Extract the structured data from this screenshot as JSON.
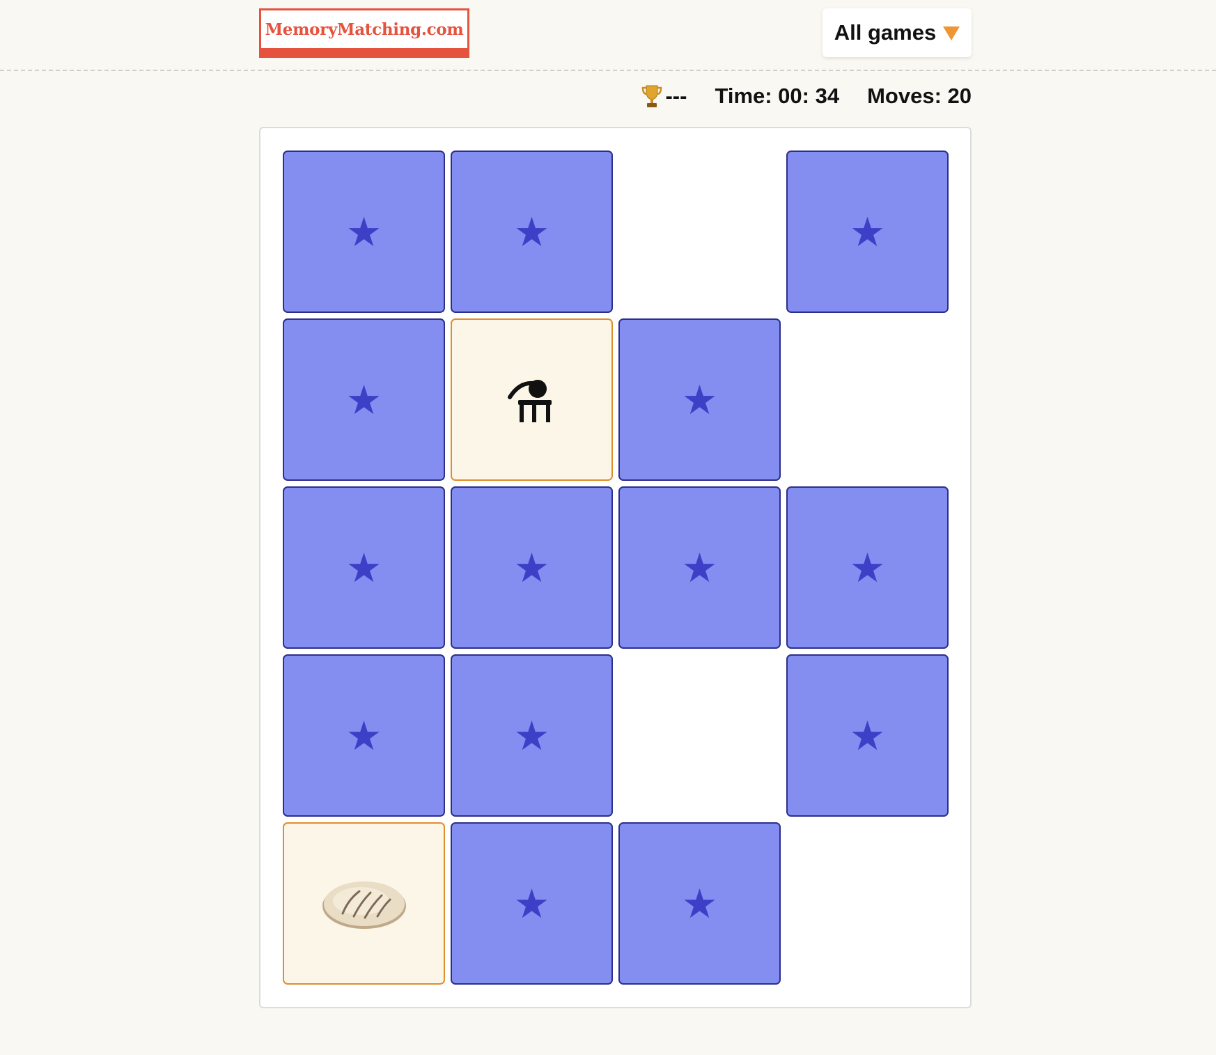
{
  "header": {
    "logo_text": "MemoryMatching.com",
    "menu_label": "All games",
    "menu_icon": "chevron-down-icon",
    "accent_color": "#e5533f",
    "arrow_color": "#ef9634"
  },
  "stats": {
    "best_icon": "trophy-icon",
    "best_value": "---",
    "time_label": "Time: 00: 34",
    "moves_label": "Moves: 20"
  },
  "board": {
    "rows": 5,
    "columns": 4,
    "hidden_card_color": "#848ef0",
    "hidden_card_border": "#2b2f8c",
    "star_color": "#3d3fc7",
    "revealed_card_color": "#fbf6e7",
    "revealed_card_border": "#e08d2c",
    "back_glyph": "★",
    "cells": [
      [
        "hidden",
        "hidden",
        "empty",
        "hidden"
      ],
      [
        "hidden",
        "revealed:stool-symbol",
        "hidden",
        "empty"
      ],
      [
        "hidden",
        "hidden",
        "hidden",
        "hidden"
      ],
      [
        "hidden",
        "hidden",
        "empty",
        "hidden"
      ],
      [
        "revealed:pita-bread",
        "hidden",
        "hidden",
        "empty"
      ]
    ]
  }
}
